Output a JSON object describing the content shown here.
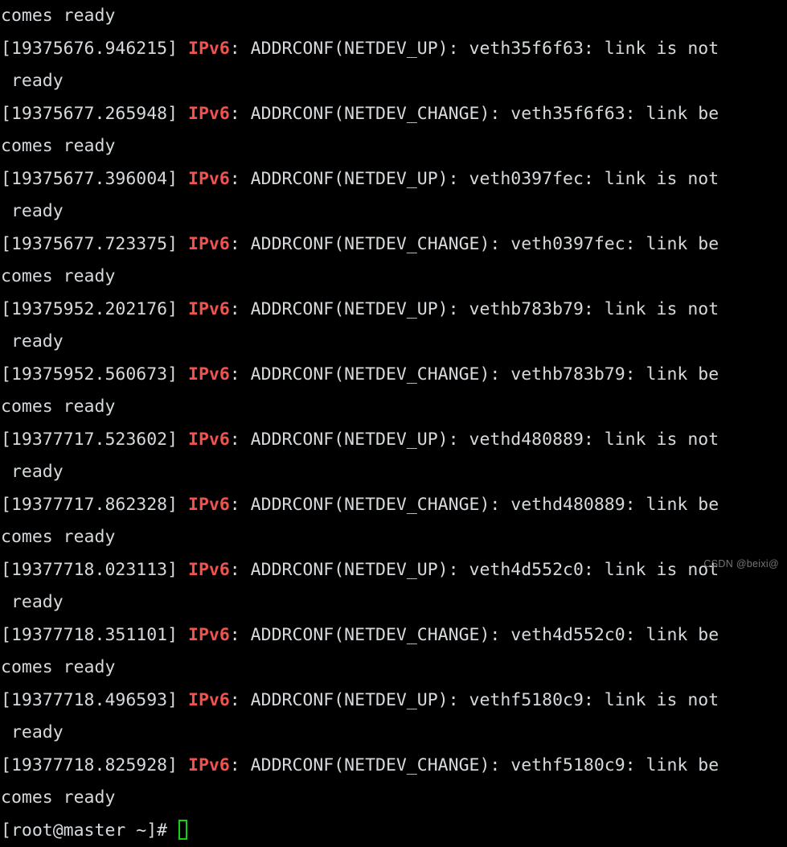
{
  "terminal": {
    "background_color": "#000000",
    "foreground_color": "#d6dadd",
    "accent_color": "#f0534f",
    "cursor_color": "#14d014",
    "columns": 80,
    "rows": 18,
    "lines": [
      {
        "kind": "wrap",
        "text": "comes ready"
      },
      {
        "kind": "log",
        "timestamp": "[19375676.946215]",
        "proto": "IPv6",
        "message": ": ADDRCONF(NETDEV_UP): veth35f6f63: link is not"
      },
      {
        "kind": "wrap",
        "text": " ready"
      },
      {
        "kind": "log",
        "timestamp": "[19375677.265948]",
        "proto": "IPv6",
        "message": ": ADDRCONF(NETDEV_CHANGE): veth35f6f63: link be"
      },
      {
        "kind": "wrap",
        "text": "comes ready"
      },
      {
        "kind": "log",
        "timestamp": "[19375677.396004]",
        "proto": "IPv6",
        "message": ": ADDRCONF(NETDEV_UP): veth0397fec: link is not"
      },
      {
        "kind": "wrap",
        "text": " ready"
      },
      {
        "kind": "log",
        "timestamp": "[19375677.723375]",
        "proto": "IPv6",
        "message": ": ADDRCONF(NETDEV_CHANGE): veth0397fec: link be"
      },
      {
        "kind": "wrap",
        "text": "comes ready"
      },
      {
        "kind": "log",
        "timestamp": "[19375952.202176]",
        "proto": "IPv6",
        "message": ": ADDRCONF(NETDEV_UP): vethb783b79: link is not"
      },
      {
        "kind": "wrap",
        "text": " ready"
      },
      {
        "kind": "log",
        "timestamp": "[19375952.560673]",
        "proto": "IPv6",
        "message": ": ADDRCONF(NETDEV_CHANGE): vethb783b79: link be"
      },
      {
        "kind": "wrap",
        "text": "comes ready"
      },
      {
        "kind": "log",
        "timestamp": "[19377717.523602]",
        "proto": "IPv6",
        "message": ": ADDRCONF(NETDEV_UP): vethd480889: link is not"
      },
      {
        "kind": "wrap",
        "text": " ready"
      },
      {
        "kind": "log",
        "timestamp": "[19377717.862328]",
        "proto": "IPv6",
        "message": ": ADDRCONF(NETDEV_CHANGE): vethd480889: link be"
      },
      {
        "kind": "wrap",
        "text": "comes ready"
      },
      {
        "kind": "log",
        "timestamp": "[19377718.023113]",
        "proto": "IPv6",
        "message": ": ADDRCONF(NETDEV_UP): veth4d552c0: link is not"
      },
      {
        "kind": "wrap",
        "text": " ready"
      },
      {
        "kind": "log",
        "timestamp": "[19377718.351101]",
        "proto": "IPv6",
        "message": ": ADDRCONF(NETDEV_CHANGE): veth4d552c0: link be"
      },
      {
        "kind": "wrap",
        "text": "comes ready"
      },
      {
        "kind": "log",
        "timestamp": "[19377718.496593]",
        "proto": "IPv6",
        "message": ": ADDRCONF(NETDEV_UP): vethf5180c9: link is not"
      },
      {
        "kind": "wrap",
        "text": " ready"
      },
      {
        "kind": "log",
        "timestamp": "[19377718.825928]",
        "proto": "IPv6",
        "message": ": ADDRCONF(NETDEV_CHANGE): vethf5180c9: link be"
      },
      {
        "kind": "wrap",
        "text": "comes ready"
      },
      {
        "kind": "prompt",
        "text": "[root@master ~]# "
      }
    ]
  },
  "watermark": {
    "text": "CSDN @beixi@"
  }
}
